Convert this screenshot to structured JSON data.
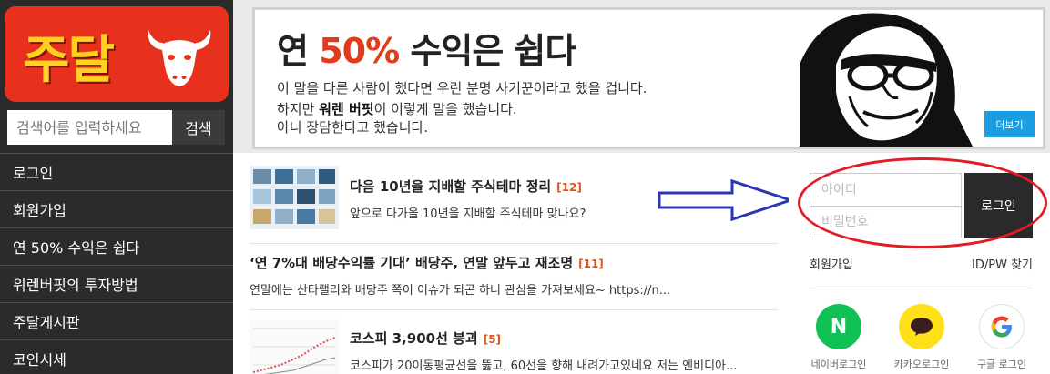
{
  "sidebar": {
    "logo_text": "주달",
    "search": {
      "placeholder": "검색어를 입력하세요",
      "button": "검색"
    },
    "menu": [
      "로그인",
      "회원가입",
      "연 50% 수익은 쉽다",
      "워렌버핏의 투자방법",
      "주달게시판",
      "코인시세"
    ]
  },
  "banner": {
    "title_prefix": "연 ",
    "title_highlight": "50%",
    "title_suffix": " 수익은 쉽다",
    "line1": "이 말을 다른 사람이 했다면 우린 분명 사기꾼이라고 했을 겁니다.",
    "line2_prefix": "하지만 ",
    "line2_bold": "워렌 버핏",
    "line2_suffix": "이 이렇게 말을 했습니다.",
    "line3": "아니 장담한다고 했습니다.",
    "more_button": "더보기"
  },
  "posts": [
    {
      "title": "다음 10년을 지배할 주식테마 정리",
      "count": "[12]",
      "desc": "앞으로 다가올 10년을 지배할 주식테마 맞나요?"
    },
    {
      "title": "‘연 7%대 배당수익률 기대’ 배당주, 연말 앞두고 재조명",
      "count": "[11]",
      "desc": "연말에는 산타랠리와 배당주 쪽이 이슈가 되곤 하니 관심을 가져보세요~ https://n..."
    },
    {
      "title": "코스피 3,900선 붕괴",
      "count": "[5]",
      "desc": "코스피가 20이동평균선을 뚫고, 60선을 향해 내려가고있네요 저는 엔비디아..."
    }
  ],
  "login": {
    "id_placeholder": "아이디",
    "pw_placeholder": "비밀번호",
    "button": "로그인",
    "signup": "회원가입",
    "find": "ID/PW 찾기",
    "social": [
      {
        "label": "네이버로그인",
        "icon": "naver-icon",
        "color": "#0fc054",
        "glyph": "N"
      },
      {
        "label": "카카오로그인",
        "icon": "kakao-icon",
        "color": "#ffe11a"
      },
      {
        "label": "구글 로그인",
        "icon": "google-icon",
        "color": "#ffffff"
      }
    ]
  },
  "colors": {
    "brand_red": "#e8311c",
    "logo_yellow": "#ffd21f",
    "highlight": "#e23b1b",
    "annotation_red": "#e31b23",
    "annotation_blue": "#2b35b5"
  }
}
